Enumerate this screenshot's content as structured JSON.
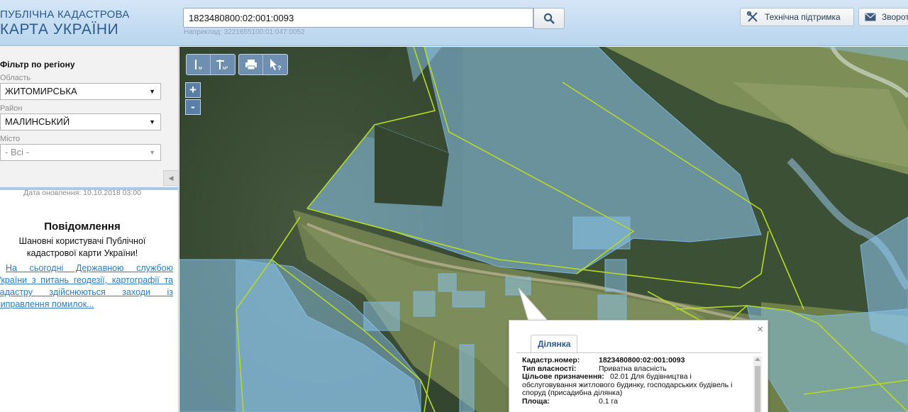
{
  "header": {
    "logo_line1": "ПУБЛІЧНА КАДАСТРОВА",
    "logo_line2": "КАРТА УКРАЇНИ",
    "search_value": "1823480800:02:001:0093",
    "search_example": "Наприклад: 3221655100:01:047:0052",
    "search_icon": "search-icon",
    "support_label": "Технічна підтримка",
    "support_icon": "tools-icon",
    "feedback_label": "Зворотній",
    "feedback_icon": "envelope-icon",
    "colors": {
      "header_bg": "#c6ddf2",
      "logo_text": "#2b5a8c"
    }
  },
  "sidebar": {
    "filter_title": "Фільтр по регіону",
    "region_label": "Область",
    "region_value": "ЖИТОМИРСЬКА",
    "district_label": "Район",
    "district_value": "МАЛИНСЬКИЙ",
    "city_label": "Місто",
    "city_value": "- Всі -",
    "update_date": "Дата оновлення: 10.10.2018 03:00",
    "notice_title": "Повідомлення",
    "notice_greeting": "Шановні користувачі Публічної кадастрової карти України!",
    "notice_link": "На сьогодні Державною службою України з питань геодезії, картографії та кадастру здійснюються заходи із виправлення помилок..."
  },
  "map": {
    "tools": [
      {
        "icon": "measure-length-icon",
        "sub": "м"
      },
      {
        "icon": "measure-area-icon",
        "sub": "м²"
      },
      {
        "icon": "print-icon",
        "sub": ""
      },
      {
        "icon": "info-pointer-icon",
        "sub": "?"
      }
    ],
    "zoom_in": "+",
    "zoom_out": "-",
    "colors": {
      "parcel_fill": "#8ec8f0",
      "boundary": "#b6d82a",
      "forest": "#3a4d36"
    }
  },
  "popup": {
    "tab": "Ділянка",
    "close": "×",
    "rows": [
      {
        "key": "Кадастр.номер:",
        "value": "1823480800:02:001:0093"
      },
      {
        "key": "Тип власності:",
        "value": "Приватна власність"
      },
      {
        "key": "Цільове призначення:",
        "value": "02.01 Для будівництва і обслуговування житлового будинку, господарських будівель і споруд (присадибна ділянка)"
      },
      {
        "key": "Площа:",
        "value": "0.1 га"
      }
    ]
  }
}
